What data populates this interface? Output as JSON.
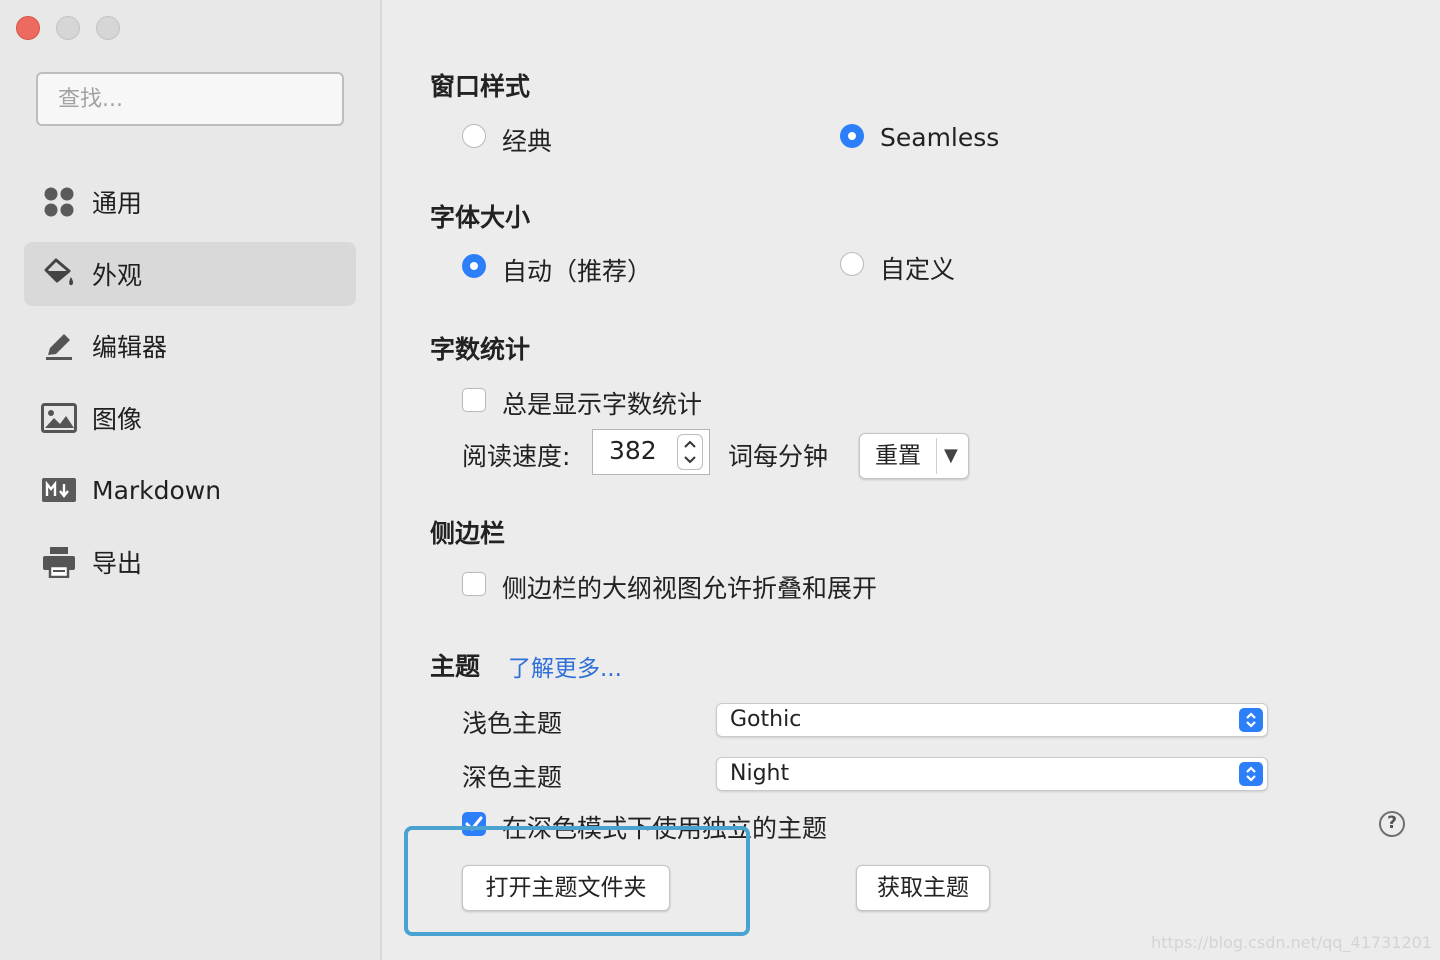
{
  "sidebar": {
    "search_placeholder": "查找...",
    "items": [
      {
        "label": "通用",
        "icon": "grid-icon"
      },
      {
        "label": "外观",
        "icon": "paint-bucket-icon",
        "active": true
      },
      {
        "label": "编辑器",
        "icon": "pencil-icon"
      },
      {
        "label": "图像",
        "icon": "image-icon"
      },
      {
        "label": "Markdown",
        "icon": "markdown-icon"
      },
      {
        "label": "导出",
        "icon": "printer-icon"
      }
    ]
  },
  "window_style": {
    "title": "窗口样式",
    "options": [
      {
        "label": "经典",
        "selected": false
      },
      {
        "label": "Seamless",
        "selected": true
      }
    ]
  },
  "font_size": {
    "title": "字体大小",
    "options": [
      {
        "label": "自动（推荐）",
        "selected": true
      },
      {
        "label": "自定义",
        "selected": false
      }
    ]
  },
  "word_count": {
    "title": "字数统计",
    "always_show_label": "总是显示字数统计",
    "always_show_checked": false,
    "reading_speed_label": "阅读速度:",
    "reading_speed_value": "382",
    "unit_label": "词每分钟",
    "reset_label": "重置",
    "reset_menu_arrow": "▼"
  },
  "sidebar_section": {
    "title": "侧边栏",
    "collapse_label": "侧边栏的大纲视图允许折叠和展开",
    "collapse_checked": false
  },
  "theme": {
    "title": "主题",
    "learn_more": "了解更多...",
    "light_label": "浅色主题",
    "light_value": "Gothic",
    "dark_label": "深色主题",
    "dark_value": "Night",
    "separate_label": "在深色模式下使用独立的主题",
    "separate_checked": true,
    "open_folder_label": "打开主题文件夹",
    "get_themes_label": "获取主题",
    "help_glyph": "?"
  },
  "watermark": "https://blog.csdn.net/qq_41731201",
  "colors": {
    "accent": "#2d7ff9",
    "highlight_border": "#4aa2d0",
    "link": "#2f70d8"
  }
}
